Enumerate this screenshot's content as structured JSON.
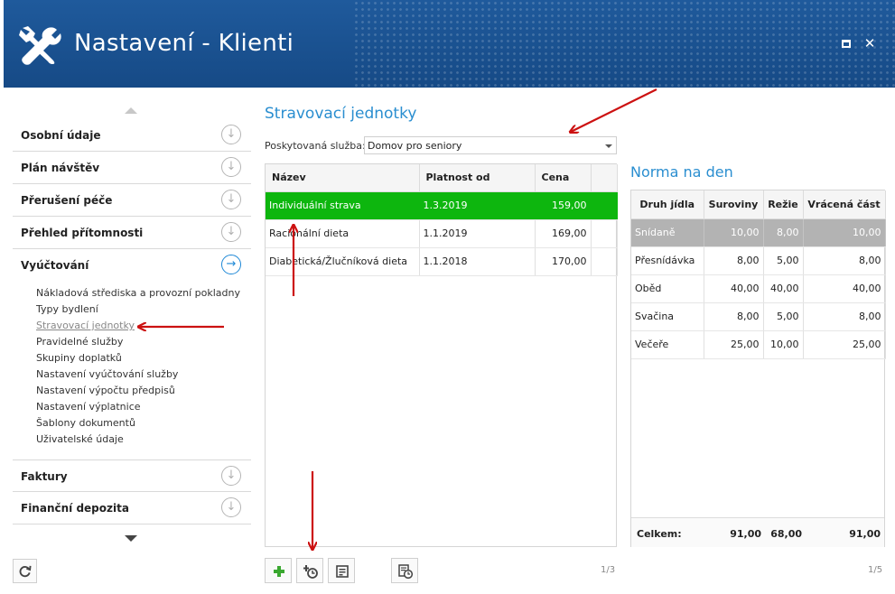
{
  "window": {
    "title": "Nastavení - Klienti",
    "maximize_icon": "maximize-icon",
    "close_label": "✕"
  },
  "nav": {
    "items": [
      {
        "label": "Osobní údaje"
      },
      {
        "label": "Plán návštěv"
      },
      {
        "label": "Přerušení péče"
      },
      {
        "label": "Přehled přítomnosti"
      },
      {
        "label": "Vyúčtování"
      },
      {
        "label": "Faktury"
      },
      {
        "label": "Finanční depozita"
      }
    ],
    "active_section": "Vyúčtování",
    "sub_items": [
      "Nákladová střediska a provozní pokladny",
      "Typy bydlení",
      "Stravovací jednotky",
      "Pravidelné služby",
      "Skupiny doplatků",
      "Nastavení vyúčtování služby",
      "Nastavení výpočtu předpisů",
      "Nastavení výplatnice",
      "Šablony dokumentů",
      "Uživatelské údaje"
    ],
    "active_sub_item": "Stravovací jednotky"
  },
  "units": {
    "title": "Stravovací jednotky",
    "service_label": "Poskytovaná služba:",
    "service_value": "Domov pro seniory",
    "columns": [
      "Název",
      "Platnost od",
      "Cena"
    ],
    "rows": [
      {
        "name": "Individuální strava",
        "valid_from": "1.3.2019",
        "price": "159,00",
        "selected": true
      },
      {
        "name": "Racionální dieta",
        "valid_from": "1.1.2019",
        "price": "169,00",
        "selected": false
      },
      {
        "name": "Diabetická/Žlučníková dieta",
        "valid_from": "1.1.2018",
        "price": "170,00",
        "selected": false
      }
    ],
    "pager": "1/3",
    "toolbar": [
      "add-icon",
      "add-validity-icon",
      "edit-icon",
      "history-icon"
    ]
  },
  "norm": {
    "title": "Norma na den",
    "columns": [
      "Druh jídla",
      "Suroviny",
      "Režie",
      "Vrácená část"
    ],
    "rows": [
      {
        "meal": "Snídaně",
        "raw": "10,00",
        "overhead": "8,00",
        "returned": "10,00",
        "selected": true
      },
      {
        "meal": "Přesnídávka",
        "raw": "8,00",
        "overhead": "5,00",
        "returned": "8,00",
        "selected": false
      },
      {
        "meal": "Oběd",
        "raw": "40,00",
        "overhead": "40,00",
        "returned": "40,00",
        "selected": false
      },
      {
        "meal": "Svačina",
        "raw": "8,00",
        "overhead": "5,00",
        "returned": "8,00",
        "selected": false
      },
      {
        "meal": "Večeře",
        "raw": "25,00",
        "overhead": "10,00",
        "returned": "25,00",
        "selected": false
      }
    ],
    "total_label": "Celkem:",
    "total_raw": "91,00",
    "total_overhead": "68,00",
    "total_returned": "91,00",
    "pager": "1/5"
  },
  "colors": {
    "header_blue": "#1f5a9c",
    "accent_blue": "#2a8ed0",
    "selected_green": "#0db60e",
    "selected_gray": "#b3b3b3",
    "annotation_red": "#cc1111"
  }
}
